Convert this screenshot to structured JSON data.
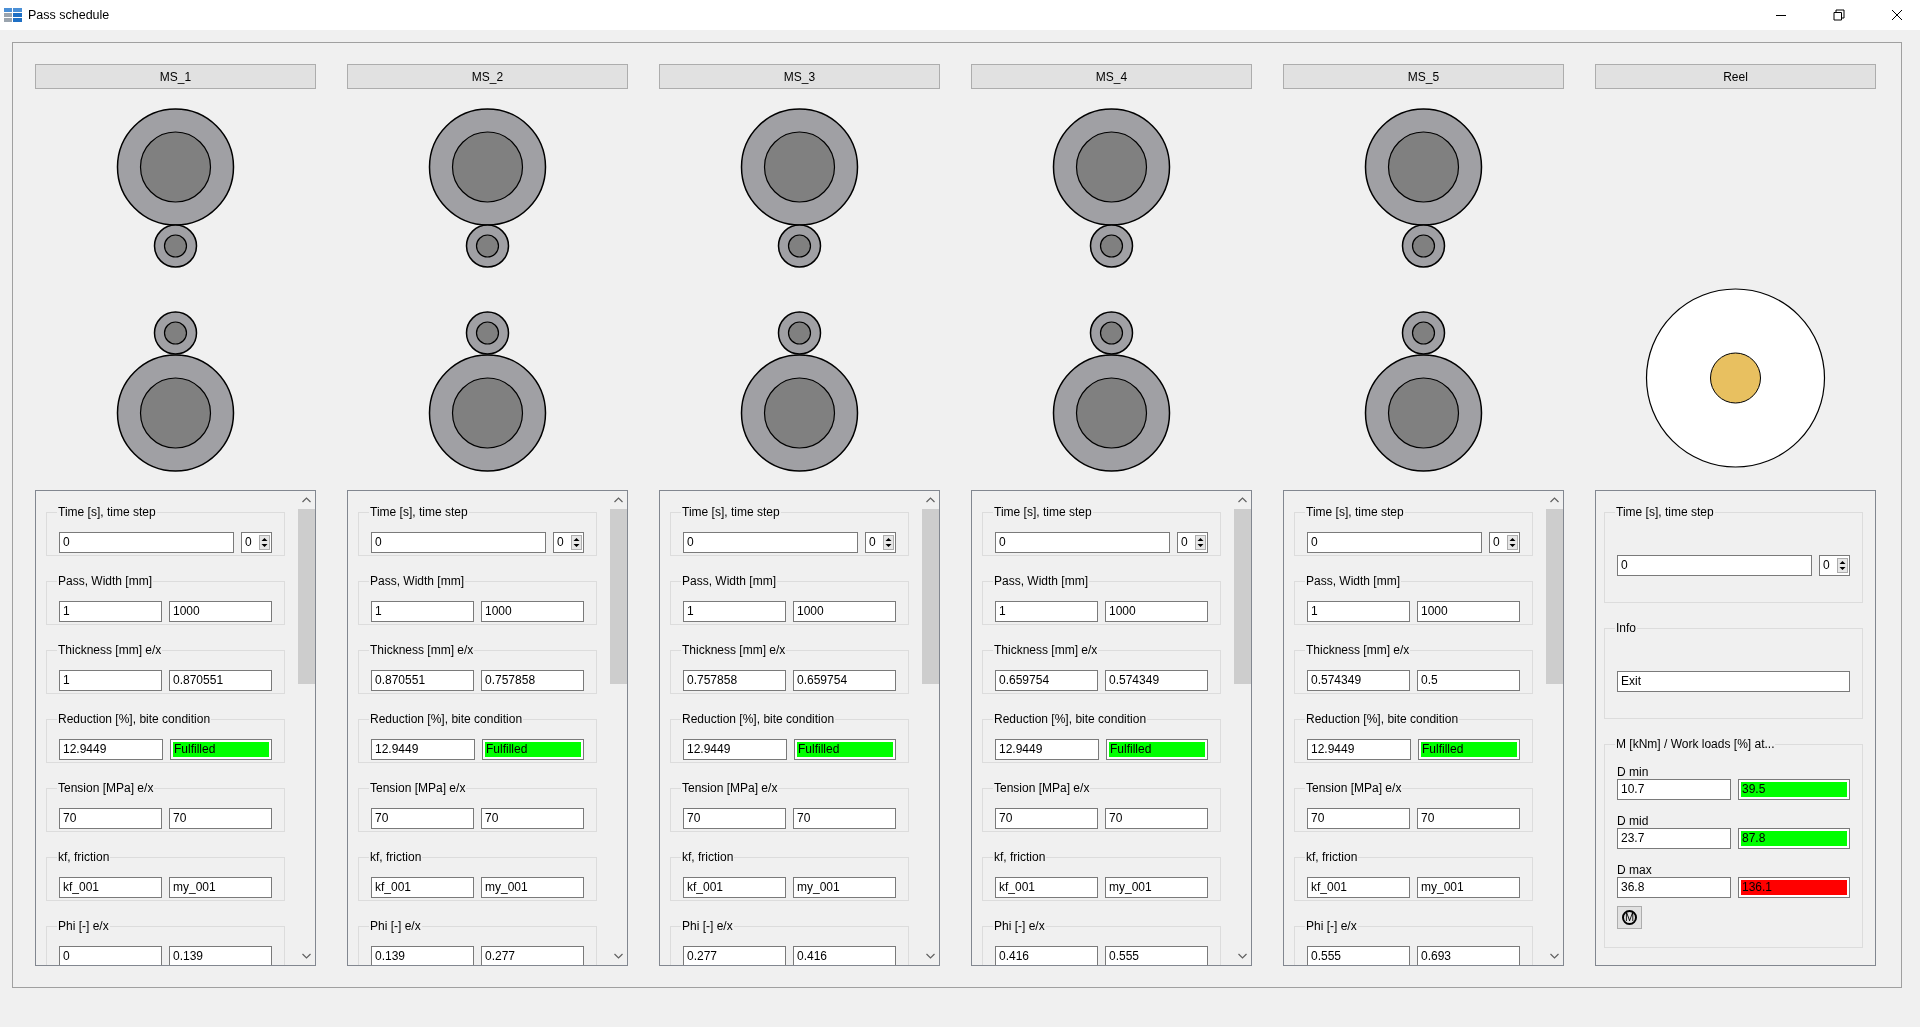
{
  "window": {
    "title": "Pass schedule"
  },
  "stands": [
    {
      "name": "MS_1",
      "groups": [
        {
          "label": "Time [s], time step",
          "fields": [
            {
              "kind": "text",
              "value": "0"
            },
            {
              "kind": "spin",
              "value": "0"
            }
          ]
        },
        {
          "label": "Pass, Width [mm]",
          "fields": [
            {
              "kind": "text",
              "value": "1"
            },
            {
              "kind": "text",
              "value": "1000"
            }
          ]
        },
        {
          "label": "Thickness [mm] e/x",
          "fields": [
            {
              "kind": "text",
              "value": "1"
            },
            {
              "kind": "text",
              "value": "0.870551"
            }
          ]
        },
        {
          "label": "Reduction [%], bite condition",
          "fields": [
            {
              "kind": "text",
              "value": "12.9449"
            },
            {
              "kind": "status",
              "value": "Fulfilled",
              "color": "#00ff00"
            }
          ]
        },
        {
          "label": "Tension [MPa] e/x",
          "fields": [
            {
              "kind": "text",
              "value": "70"
            },
            {
              "kind": "text",
              "value": "70"
            }
          ]
        },
        {
          "label": "kf, friction",
          "fields": [
            {
              "kind": "text",
              "value": "kf_001"
            },
            {
              "kind": "text",
              "value": "my_001"
            }
          ]
        },
        {
          "label": "Phi [-] e/x",
          "fields": [
            {
              "kind": "text",
              "value": "0"
            },
            {
              "kind": "text",
              "value": "0.139"
            }
          ]
        }
      ]
    },
    {
      "name": "MS_2",
      "groups": [
        {
          "label": "Time [s], time step",
          "fields": [
            {
              "kind": "text",
              "value": "0"
            },
            {
              "kind": "spin",
              "value": "0"
            }
          ]
        },
        {
          "label": "Pass, Width [mm]",
          "fields": [
            {
              "kind": "text",
              "value": "1"
            },
            {
              "kind": "text",
              "value": "1000"
            }
          ]
        },
        {
          "label": "Thickness [mm] e/x",
          "fields": [
            {
              "kind": "text",
              "value": "0.870551"
            },
            {
              "kind": "text",
              "value": "0.757858"
            }
          ]
        },
        {
          "label": "Reduction [%], bite condition",
          "fields": [
            {
              "kind": "text",
              "value": "12.9449"
            },
            {
              "kind": "status",
              "value": "Fulfilled",
              "color": "#00ff00"
            }
          ]
        },
        {
          "label": "Tension [MPa] e/x",
          "fields": [
            {
              "kind": "text",
              "value": "70"
            },
            {
              "kind": "text",
              "value": "70"
            }
          ]
        },
        {
          "label": "kf, friction",
          "fields": [
            {
              "kind": "text",
              "value": "kf_001"
            },
            {
              "kind": "text",
              "value": "my_001"
            }
          ]
        },
        {
          "label": "Phi [-] e/x",
          "fields": [
            {
              "kind": "text",
              "value": "0.139"
            },
            {
              "kind": "text",
              "value": "0.277"
            }
          ]
        }
      ]
    },
    {
      "name": "MS_3",
      "groups": [
        {
          "label": "Time [s], time step",
          "fields": [
            {
              "kind": "text",
              "value": "0"
            },
            {
              "kind": "spin",
              "value": "0"
            }
          ]
        },
        {
          "label": "Pass, Width [mm]",
          "fields": [
            {
              "kind": "text",
              "value": "1"
            },
            {
              "kind": "text",
              "value": "1000"
            }
          ]
        },
        {
          "label": "Thickness [mm] e/x",
          "fields": [
            {
              "kind": "text",
              "value": "0.757858"
            },
            {
              "kind": "text",
              "value": "0.659754"
            }
          ]
        },
        {
          "label": "Reduction [%], bite condition",
          "fields": [
            {
              "kind": "text",
              "value": "12.9449"
            },
            {
              "kind": "status",
              "value": "Fulfilled",
              "color": "#00ff00"
            }
          ]
        },
        {
          "label": "Tension [MPa] e/x",
          "fields": [
            {
              "kind": "text",
              "value": "70"
            },
            {
              "kind": "text",
              "value": "70"
            }
          ]
        },
        {
          "label": "kf, friction",
          "fields": [
            {
              "kind": "text",
              "value": "kf_001"
            },
            {
              "kind": "text",
              "value": "my_001"
            }
          ]
        },
        {
          "label": "Phi [-] e/x",
          "fields": [
            {
              "kind": "text",
              "value": "0.277"
            },
            {
              "kind": "text",
              "value": "0.416"
            }
          ]
        }
      ]
    },
    {
      "name": "MS_4",
      "groups": [
        {
          "label": "Time [s], time step",
          "fields": [
            {
              "kind": "text",
              "value": "0"
            },
            {
              "kind": "spin",
              "value": "0"
            }
          ]
        },
        {
          "label": "Pass, Width [mm]",
          "fields": [
            {
              "kind": "text",
              "value": "1"
            },
            {
              "kind": "text",
              "value": "1000"
            }
          ]
        },
        {
          "label": "Thickness [mm] e/x",
          "fields": [
            {
              "kind": "text",
              "value": "0.659754"
            },
            {
              "kind": "text",
              "value": "0.574349"
            }
          ]
        },
        {
          "label": "Reduction [%], bite condition",
          "fields": [
            {
              "kind": "text",
              "value": "12.9449"
            },
            {
              "kind": "status",
              "value": "Fulfilled",
              "color": "#00ff00"
            }
          ]
        },
        {
          "label": "Tension [MPa] e/x",
          "fields": [
            {
              "kind": "text",
              "value": "70"
            },
            {
              "kind": "text",
              "value": "70"
            }
          ]
        },
        {
          "label": "kf, friction",
          "fields": [
            {
              "kind": "text",
              "value": "kf_001"
            },
            {
              "kind": "text",
              "value": "my_001"
            }
          ]
        },
        {
          "label": "Phi [-] e/x",
          "fields": [
            {
              "kind": "text",
              "value": "0.416"
            },
            {
              "kind": "text",
              "value": "0.555"
            }
          ]
        }
      ]
    },
    {
      "name": "MS_5",
      "groups": [
        {
          "label": "Time [s], time step",
          "fields": [
            {
              "kind": "text",
              "value": "0"
            },
            {
              "kind": "spin",
              "value": "0"
            }
          ]
        },
        {
          "label": "Pass, Width [mm]",
          "fields": [
            {
              "kind": "text",
              "value": "1"
            },
            {
              "kind": "text",
              "value": "1000"
            }
          ]
        },
        {
          "label": "Thickness [mm] e/x",
          "fields": [
            {
              "kind": "text",
              "value": "0.574349"
            },
            {
              "kind": "text",
              "value": "0.5"
            }
          ]
        },
        {
          "label": "Reduction [%], bite condition",
          "fields": [
            {
              "kind": "text",
              "value": "12.9449"
            },
            {
              "kind": "status",
              "value": "Fulfilled",
              "color": "#00ff00"
            }
          ]
        },
        {
          "label": "Tension [MPa] e/x",
          "fields": [
            {
              "kind": "text",
              "value": "70"
            },
            {
              "kind": "text",
              "value": "70"
            }
          ]
        },
        {
          "label": "kf, friction",
          "fields": [
            {
              "kind": "text",
              "value": "kf_001"
            },
            {
              "kind": "text",
              "value": "my_001"
            }
          ]
        },
        {
          "label": "Phi [-] e/x",
          "fields": [
            {
              "kind": "text",
              "value": "0.555"
            },
            {
              "kind": "text",
              "value": "0.693"
            }
          ]
        }
      ]
    }
  ],
  "reel": {
    "name": "Reel",
    "groups": [
      {
        "label": "Time [s], time step",
        "fields": [
          {
            "kind": "text",
            "value": "0"
          },
          {
            "kind": "spin",
            "value": "0"
          }
        ]
      },
      {
        "label": "Info",
        "fields": [
          {
            "kind": "text",
            "value": "Exit"
          }
        ]
      }
    ],
    "loads": {
      "label": "M [kNm] / Work loads [%] at...",
      "rows": [
        {
          "label": "D min",
          "moment": "10.7",
          "load": "39.5",
          "color": "#00ff00"
        },
        {
          "label": "D mid",
          "moment": "23.7",
          "load": "87.8",
          "color": "#00ff00"
        },
        {
          "label": "D max",
          "moment": "36.8",
          "load": "136.1",
          "color": "#ff0000"
        }
      ]
    },
    "motor_button": {
      "label": "M"
    }
  }
}
